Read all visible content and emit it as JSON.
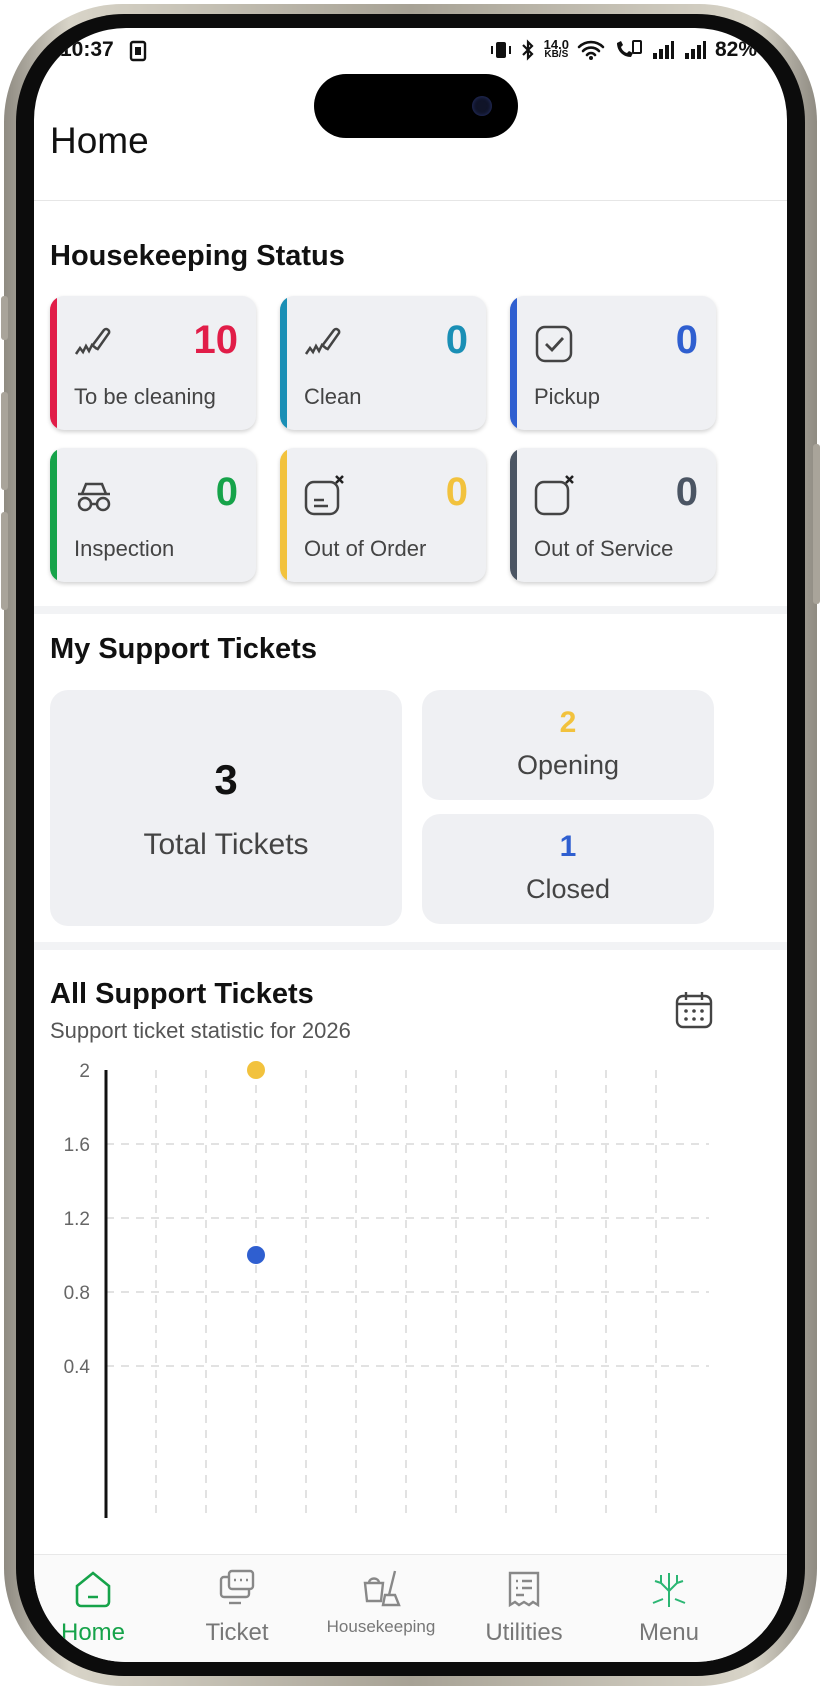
{
  "status_bar": {
    "time": "10:37",
    "speed_value": "14.0",
    "speed_unit": "KB/S",
    "battery": "82%"
  },
  "header": {
    "title": "Home"
  },
  "housekeeping": {
    "heading": "Housekeeping Status",
    "cards": [
      {
        "label": "To be cleaning",
        "count": "10",
        "color": "#e11d48",
        "icon": "brush-icon"
      },
      {
        "label": "Clean",
        "count": "0",
        "color": "#1a8fb5",
        "icon": "brush-icon"
      },
      {
        "label": "Pickup",
        "count": "0",
        "color": "#2f5fd0",
        "icon": "checkbox-icon"
      },
      {
        "label": "Inspection",
        "count": "0",
        "color": "#16a34a",
        "icon": "spy-glasses-icon"
      },
      {
        "label": "Out of Order",
        "count": "0",
        "color": "#f2c23d",
        "icon": "out-of-order-icon"
      },
      {
        "label": "Out of Service",
        "count": "0",
        "color": "#4b5563",
        "icon": "out-of-service-icon"
      }
    ]
  },
  "tickets": {
    "heading": "My Support Tickets",
    "total": {
      "value": "3",
      "label": "Total Tickets"
    },
    "opening": {
      "value": "2",
      "label": "Opening",
      "color": "#f2c23d"
    },
    "closed": {
      "value": "1",
      "label": "Closed",
      "color": "#2f5fd0"
    }
  },
  "all_tickets": {
    "heading": "All Support Tickets",
    "subtitle": "Support ticket statistic for 2026",
    "calendar_icon": "calendar-icon"
  },
  "chart_data": {
    "type": "scatter",
    "title": "",
    "xlabel": "",
    "ylabel": "",
    "y_ticks": [
      "2",
      "1.6",
      "1.2",
      "0.8",
      "0.4"
    ],
    "ylim": [
      0,
      2
    ],
    "x_slots": 12,
    "grid": true,
    "series": [
      {
        "color": "#f2c23d",
        "points": [
          {
            "x": 3,
            "y": 2
          }
        ]
      },
      {
        "color": "#2f5fd0",
        "points": [
          {
            "x": 3,
            "y": 1
          }
        ]
      }
    ]
  },
  "bottom_nav": {
    "items": [
      {
        "label": "Home",
        "icon": "home-icon",
        "active": true
      },
      {
        "label": "Ticket",
        "icon": "ticket-chat-icon",
        "active": false
      },
      {
        "label": "Housekeeping",
        "icon": "housekeeping-icon",
        "active": false
      },
      {
        "label": "Utilities",
        "icon": "utilities-icon",
        "active": false
      },
      {
        "label": "Menu",
        "icon": "menu-tree-icon",
        "active": false
      }
    ],
    "active_color": "#16a34a"
  }
}
